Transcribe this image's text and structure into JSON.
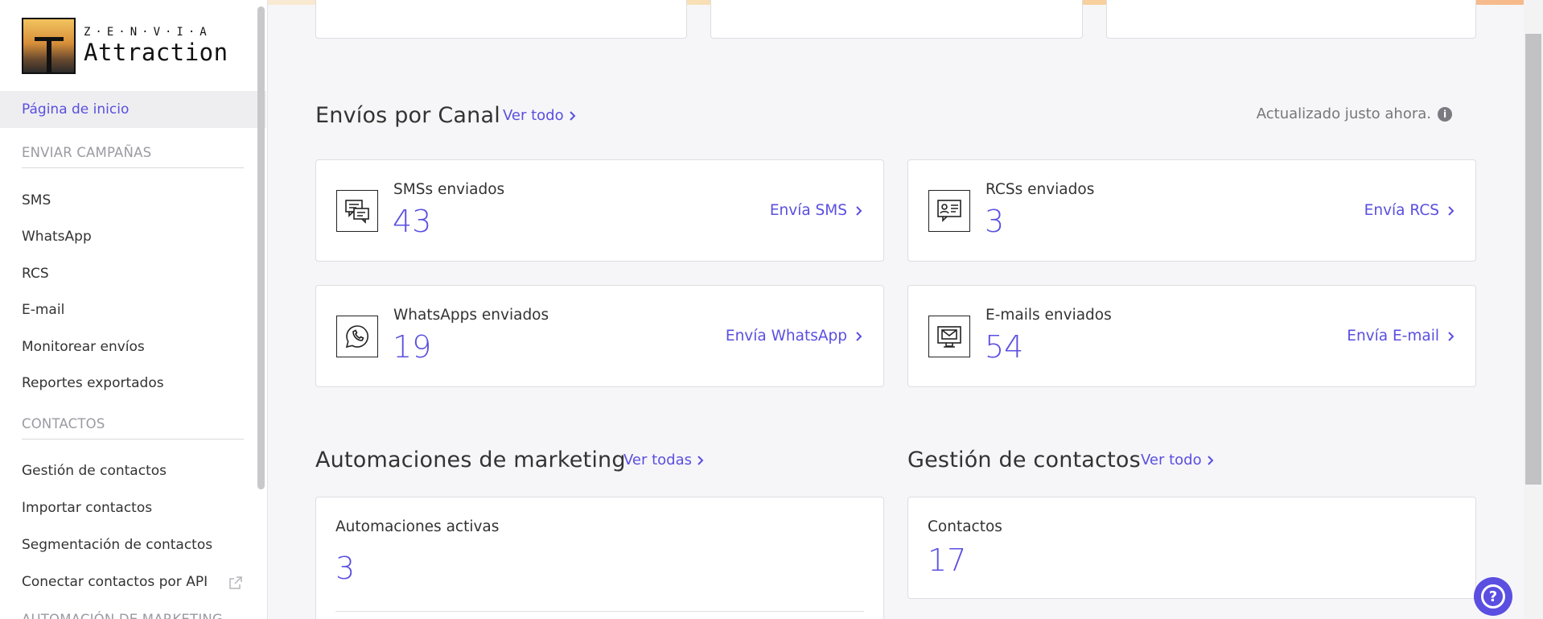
{
  "brand": {
    "company": "Z·E·N·V·I·A",
    "product": "Attraction"
  },
  "sidebar": {
    "home": "Página de inicio",
    "section_campaigns": "ENVIAR CAMPAÑAS",
    "campaign_items": [
      "SMS",
      "WhatsApp",
      "RCS",
      "E-mail",
      "Monitorear envíos",
      "Reportes exportados"
    ],
    "section_contacts": "CONTACTOS",
    "contact_items": [
      "Gestión de contactos",
      "Importar contactos",
      "Segmentación de contactos",
      "Conectar contactos por API"
    ],
    "section_automation": "AUTOMACIÓN DE MARKETING"
  },
  "channels": {
    "title": "Envíos por Canal",
    "see_all": "Ver todo",
    "updated": "Actualizado justo ahora.",
    "cards": [
      {
        "label": "SMSs enviados",
        "count": "43",
        "link": "Envía SMS",
        "icon": "sms-icon"
      },
      {
        "label": "RCSs enviados",
        "count": "3",
        "link": "Envía RCS",
        "icon": "rcs-icon"
      },
      {
        "label": "WhatsApps enviados",
        "count": "19",
        "link": "Envía WhatsApp",
        "icon": "whatsapp-icon"
      },
      {
        "label": "E-mails enviados",
        "count": "54",
        "link": "Envía E-mail",
        "icon": "email-icon"
      }
    ]
  },
  "automations": {
    "title": "Automaciones de marketing",
    "see_all": "Ver todas",
    "label": "Automaciones activas",
    "count": "3"
  },
  "contacts": {
    "title": "Gestión de contactos",
    "see_all": "Ver todo",
    "label": "Contactos",
    "count": "17"
  },
  "colors": {
    "accent": "#5a4fe0",
    "text": "#333333",
    "muted": "#9a9aa2",
    "background": "#f6f6f8"
  }
}
